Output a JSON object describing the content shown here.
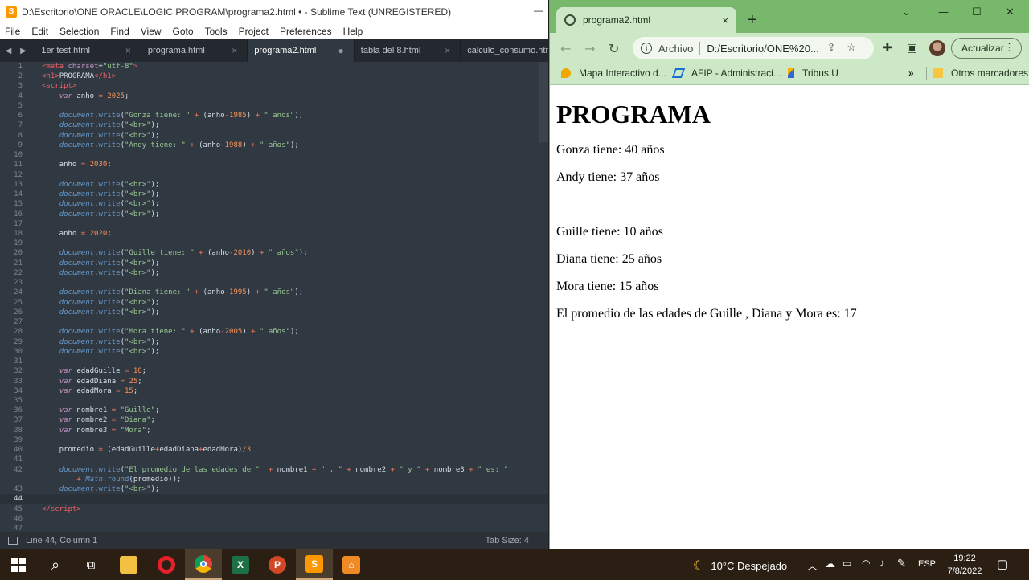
{
  "sublime": {
    "title": "D:\\Escritorio\\ONE ORACLE\\LOGIC PROGRAM\\programa2.html • - Sublime Text (UNREGISTERED)",
    "minimize": "—",
    "menu": [
      "File",
      "Edit",
      "Selection",
      "Find",
      "View",
      "Goto",
      "Tools",
      "Project",
      "Preferences",
      "Help"
    ],
    "tabs": [
      {
        "label": "1er test.html",
        "close": "×"
      },
      {
        "label": "programa.html",
        "close": "×"
      },
      {
        "label": "programa2.html",
        "close": "●"
      },
      {
        "label": "tabla del 8.html",
        "close": "×"
      },
      {
        "label": "calculo_consumo.htm",
        "close": ""
      }
    ],
    "tab_arrows": "◀ ▶",
    "status": {
      "position": "Line 44, Column 1",
      "tab_size": "Tab Size: 4"
    }
  },
  "chrome": {
    "tab_title": "programa2.html",
    "tab_close": "×",
    "new_tab": "+",
    "win_min": "—",
    "win_max": "☐",
    "win_close": "✕",
    "win_dropdown": "⌄",
    "nav_back": "←",
    "nav_forward": "→",
    "nav_reload": "↻",
    "omnibox_scheme": "Archivo",
    "omnibox_url": "D:/Escritorio/ONE%20...",
    "update_label": "Actualizar",
    "bookmarks": [
      {
        "label": "Mapa Interactivo d...",
        "color": "#f0a800"
      },
      {
        "label": "AFIP - Administraci...",
        "color": "#1a6ed8"
      },
      {
        "label": "Tribus U",
        "color": "#3367d6"
      }
    ],
    "bookmarks_more": "»",
    "other_bookmarks": "Otros marcadores",
    "page": {
      "heading": "PROGRAMA",
      "lines": [
        "Gonza tiene: 40 años",
        "Andy tiene: 37 años",
        "",
        "Guille tiene: 10 años",
        "Diana tiene: 25 años",
        "Mora tiene: 15 años",
        "El promedio de las edades de Guille , Diana y Mora es: 17"
      ]
    }
  },
  "taskbar": {
    "weather": "10°C  Despejado",
    "lang": "ESP",
    "time": "19:22",
    "date": "7/8/2022"
  },
  "code_lines": [
    "1",
    "2",
    "3",
    "4",
    "5",
    "6",
    "7",
    "8",
    "9",
    "10",
    "11",
    "12",
    "13",
    "14",
    "15",
    "16",
    "17",
    "18",
    "19",
    "20",
    "21",
    "22",
    "23",
    "24",
    "25",
    "26",
    "27",
    "28",
    "29",
    "30",
    "31",
    "32",
    "33",
    "34",
    "35",
    "36",
    "37",
    "38",
    "39",
    "40",
    "41",
    "42",
    "",
    "43",
    "44",
    "45",
    "46",
    "47"
  ]
}
